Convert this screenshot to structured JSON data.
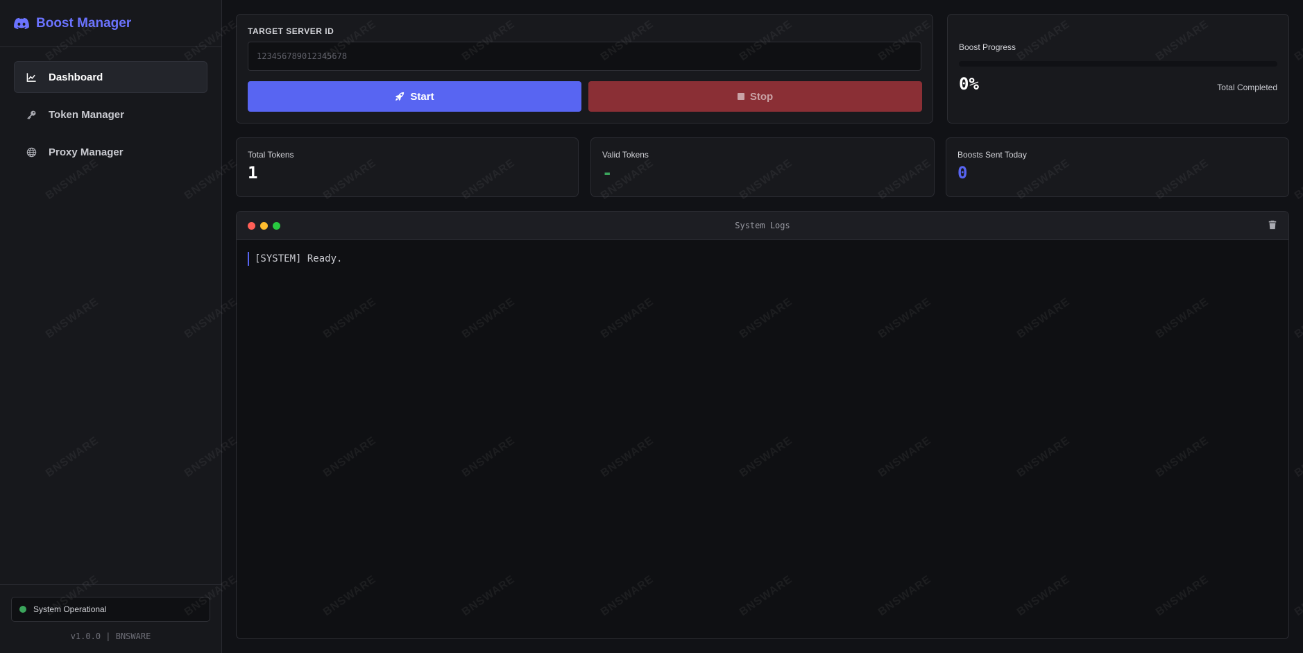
{
  "brand": {
    "title": "Boost Manager",
    "icon": "discord-icon",
    "color": "#6b73ff"
  },
  "sidebar": {
    "items": [
      {
        "label": "Dashboard",
        "icon": "chart-line-icon",
        "active": true
      },
      {
        "label": "Token Manager",
        "icon": "key-icon",
        "active": false
      },
      {
        "label": "Proxy Manager",
        "icon": "globe-icon",
        "active": false
      }
    ],
    "status": {
      "label": "System Operational",
      "color": "#3ba55c"
    },
    "version": "v1.0.0 | BNSWARE"
  },
  "target": {
    "label": "TARGET SERVER ID",
    "value": "",
    "placeholder": "123456789012345678",
    "start_label": "Start",
    "stop_label": "Stop"
  },
  "progress": {
    "label": "Boost Progress",
    "value": "0%",
    "fraction": 0,
    "subtitle": "Total Completed"
  },
  "stats": [
    {
      "label": "Total Tokens",
      "value": "1",
      "color": "#ffffff"
    },
    {
      "label": "Valid Tokens",
      "value": "-",
      "color": "#3ba55c"
    },
    {
      "label": "Boosts Sent Today",
      "value": "0",
      "color": "#5865f2"
    }
  ],
  "logs": {
    "title": "System Logs",
    "lines": [
      "[SYSTEM] Ready."
    ]
  },
  "watermark": "BNSWARE",
  "colors": {
    "accent": "#5865f2",
    "danger": "#8a2f35",
    "success": "#3ba55c"
  }
}
